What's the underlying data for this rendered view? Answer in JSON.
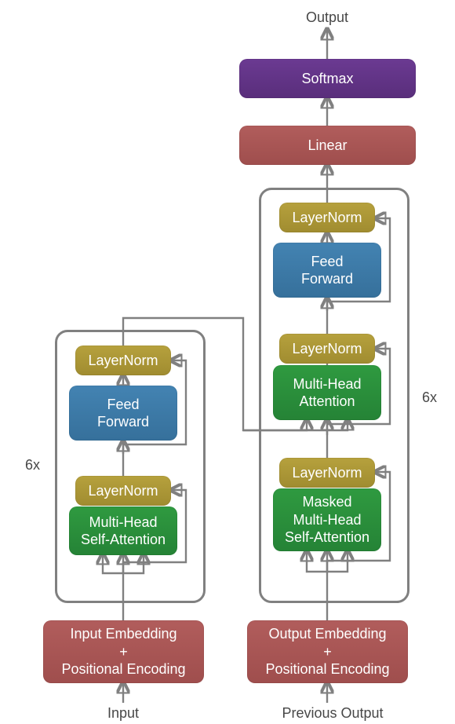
{
  "labels": {
    "output_top": "Output",
    "input_bottom": "Input",
    "prev_output_bottom": "Previous Output",
    "encoder_repeat": "6x",
    "decoder_repeat": "6x"
  },
  "blocks": {
    "softmax": "Softmax",
    "linear": "Linear",
    "decoder": {
      "layernorm_top": "LayerNorm",
      "feed_forward": "Feed\nForward",
      "layernorm_mid": "LayerNorm",
      "cross_attention": "Multi-Head\nAttention",
      "layernorm_bottom": "LayerNorm",
      "masked_self_attention": "Masked\nMulti-Head\nSelf-Attention"
    },
    "encoder": {
      "layernorm_top": "LayerNorm",
      "feed_forward": "Feed\nForward",
      "layernorm_bottom": "LayerNorm",
      "self_attention": "Multi-Head\nSelf-Attention"
    },
    "input_embedding": "Input Embedding\n+\nPositional Encoding",
    "output_embedding": "Output Embedding\n+\nPositional Encoding"
  }
}
